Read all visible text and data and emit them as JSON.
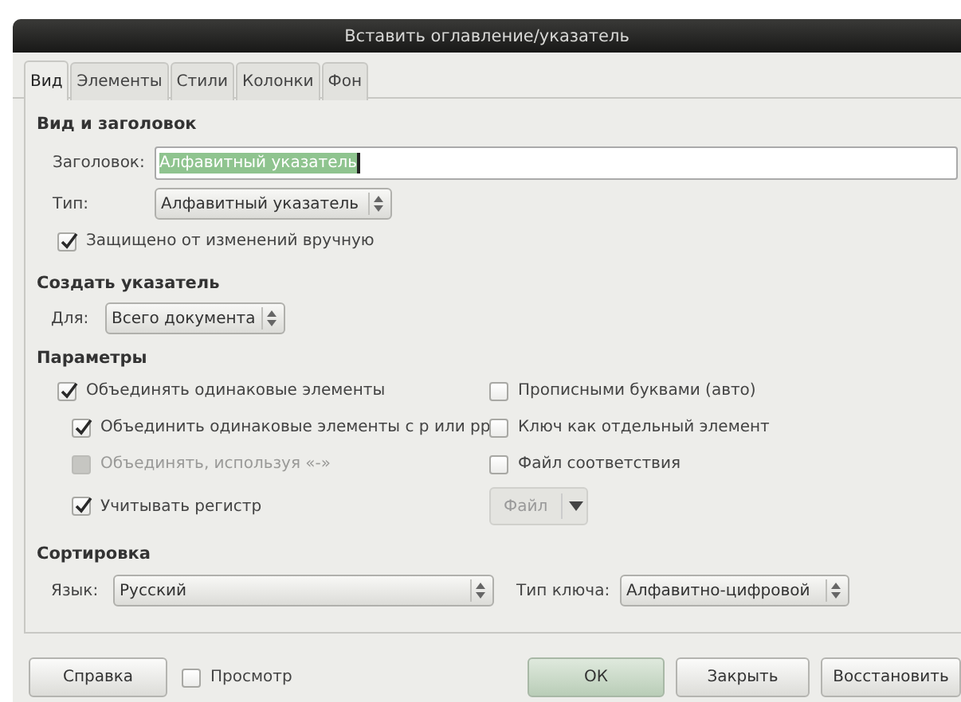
{
  "window": {
    "title": "Вставить оглавление/указатель"
  },
  "tabs": [
    {
      "label": "Вид",
      "selected": true
    },
    {
      "label": "Элементы",
      "selected": false
    },
    {
      "label": "Стили",
      "selected": false
    },
    {
      "label": "Колонки",
      "selected": false
    },
    {
      "label": "Фон",
      "selected": false
    }
  ],
  "type_and_title": {
    "heading": "Вид и заголовок",
    "title_label": "Заголовок:",
    "title_value": "Алфавитный указатель",
    "type_label": "Тип:",
    "type_value": "Алфавитный указатель",
    "protected": {
      "label": "Защищено от изменений вручную",
      "checked": true
    }
  },
  "create_index": {
    "heading": "Создать указатель",
    "for_label": "Для:",
    "for_value": "Всего документа"
  },
  "options": {
    "heading": "Параметры",
    "left": [
      {
        "label": "Объединять одинаковые элементы",
        "checked": true,
        "disabled": false,
        "children": [
          {
            "label": "Объединить одинаковые элементы с р или рр",
            "checked": true,
            "disabled": false
          },
          {
            "label": "Объединять, используя «-»",
            "checked": false,
            "disabled": true
          },
          {
            "label": "Учитывать регистр",
            "checked": true,
            "disabled": false
          }
        ]
      }
    ],
    "right": [
      {
        "kind": "checkbox",
        "label": "Прописными буквами (авто)",
        "checked": false
      },
      {
        "kind": "checkbox",
        "label": "Ключ как отдельный элемент",
        "checked": false
      },
      {
        "kind": "checkbox",
        "label": "Файл соответствия",
        "checked": false
      },
      {
        "kind": "menu-button",
        "label": "Файл",
        "disabled": true
      }
    ]
  },
  "sort": {
    "heading": "Сортировка",
    "language_label": "Язык:",
    "language_value": "Русский",
    "key_type_label": "Тип ключа:",
    "key_type_value": "Алфавитно-цифровой"
  },
  "footer": {
    "help": "Справка",
    "preview": {
      "label": "Просмотр",
      "checked": false
    },
    "buttons": [
      {
        "label": "ОК",
        "kind": "default"
      },
      {
        "label": "Закрыть",
        "kind": "normal"
      },
      {
        "label": "Восстановить",
        "kind": "normal"
      }
    ]
  }
}
